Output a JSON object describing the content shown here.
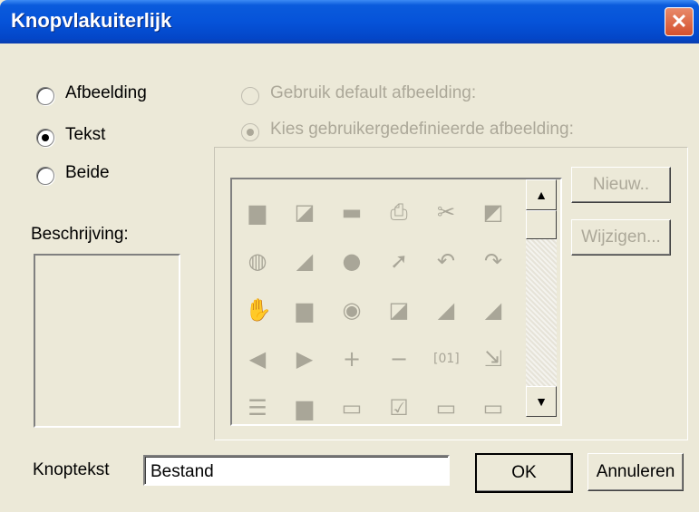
{
  "window": {
    "title": "Knopvlakuiterlijk",
    "close_glyph": "✕"
  },
  "display_mode": {
    "options": [
      {
        "label": "Afbeelding",
        "selected": false
      },
      {
        "label": "Tekst",
        "selected": true
      },
      {
        "label": "Beide",
        "selected": false
      }
    ]
  },
  "image_source": {
    "enabled": false,
    "options": [
      {
        "label": "Gebruik default afbeelding:",
        "selected": false
      },
      {
        "label": "Kies gebruikergedefinieerde afbeelding:",
        "selected": true
      }
    ]
  },
  "description": {
    "label": "Beschrijving:",
    "value": ""
  },
  "icon_grid": {
    "rows": [
      [
        "page-icon",
        "folder-open-icon",
        "save-icon",
        "print-icon",
        "scissors-icon",
        "paste-icon"
      ],
      [
        "clipboard-icon",
        "note-icon",
        "circle-icon",
        "help-pointer-icon",
        "undo-icon",
        "redo-icon"
      ],
      [
        "hand-icon",
        "page-icon",
        "compass-icon",
        "folder-icon",
        "image-icon",
        "image-icon"
      ],
      [
        "arrow-left-circle-icon",
        "arrow-right-circle-icon",
        "plus-icon",
        "minus-icon",
        "binary-icon",
        "export-icon"
      ],
      [
        "list-icon",
        "page-icon",
        "window-icon",
        "checkbox-icon",
        "window-icon",
        "window-icon"
      ]
    ],
    "glyphs": {
      "page-icon": "▆",
      "folder-open-icon": "◪",
      "save-icon": "▬",
      "print-icon": "⎙",
      "scissors-icon": "✂",
      "paste-icon": "◩",
      "clipboard-icon": "◍",
      "note-icon": "◢",
      "circle-icon": "●",
      "help-pointer-icon": "➚",
      "undo-icon": "↶",
      "redo-icon": "↷",
      "hand-icon": "✋",
      "compass-icon": "◉",
      "folder-icon": "◪",
      "image-icon": "◢",
      "arrow-left-circle-icon": "◀",
      "arrow-right-circle-icon": "▶",
      "plus-icon": "+",
      "minus-icon": "−",
      "binary-icon": "[01]",
      "export-icon": "⇲",
      "list-icon": "☰",
      "window-icon": "▭",
      "checkbox-icon": "☑"
    }
  },
  "scrollbar": {
    "up_glyph": "▲",
    "down_glyph": "▼"
  },
  "side_buttons": {
    "new_label": "Nieuw..",
    "edit_label": "Wijzigen..."
  },
  "button_text": {
    "label": "Knoptekst",
    "value": "Bestand"
  },
  "actions": {
    "ok_label": "OK",
    "cancel_label": "Annuleren"
  }
}
